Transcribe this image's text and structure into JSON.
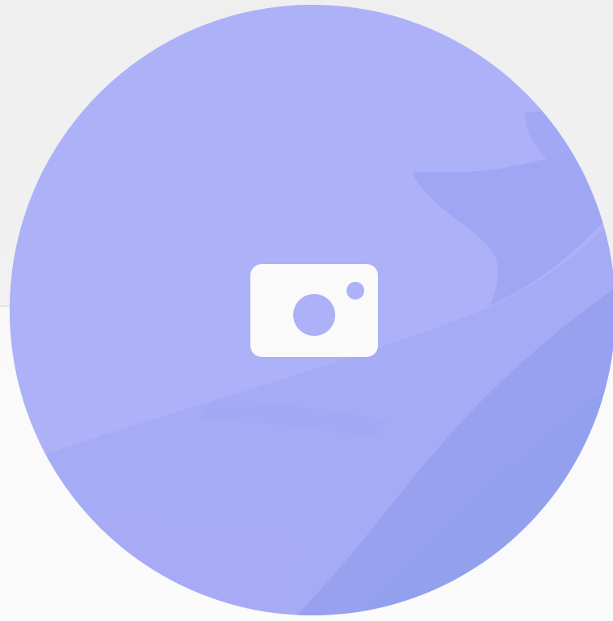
{
  "avatar": {
    "icon": "camera-icon",
    "colors": {
      "base": "#adb1f8",
      "wave_light": "#a5a9f6",
      "wave_mid": "#9ca4f2",
      "wave_dark": "#93a0ee",
      "icon_fill": "#fafafa"
    }
  }
}
